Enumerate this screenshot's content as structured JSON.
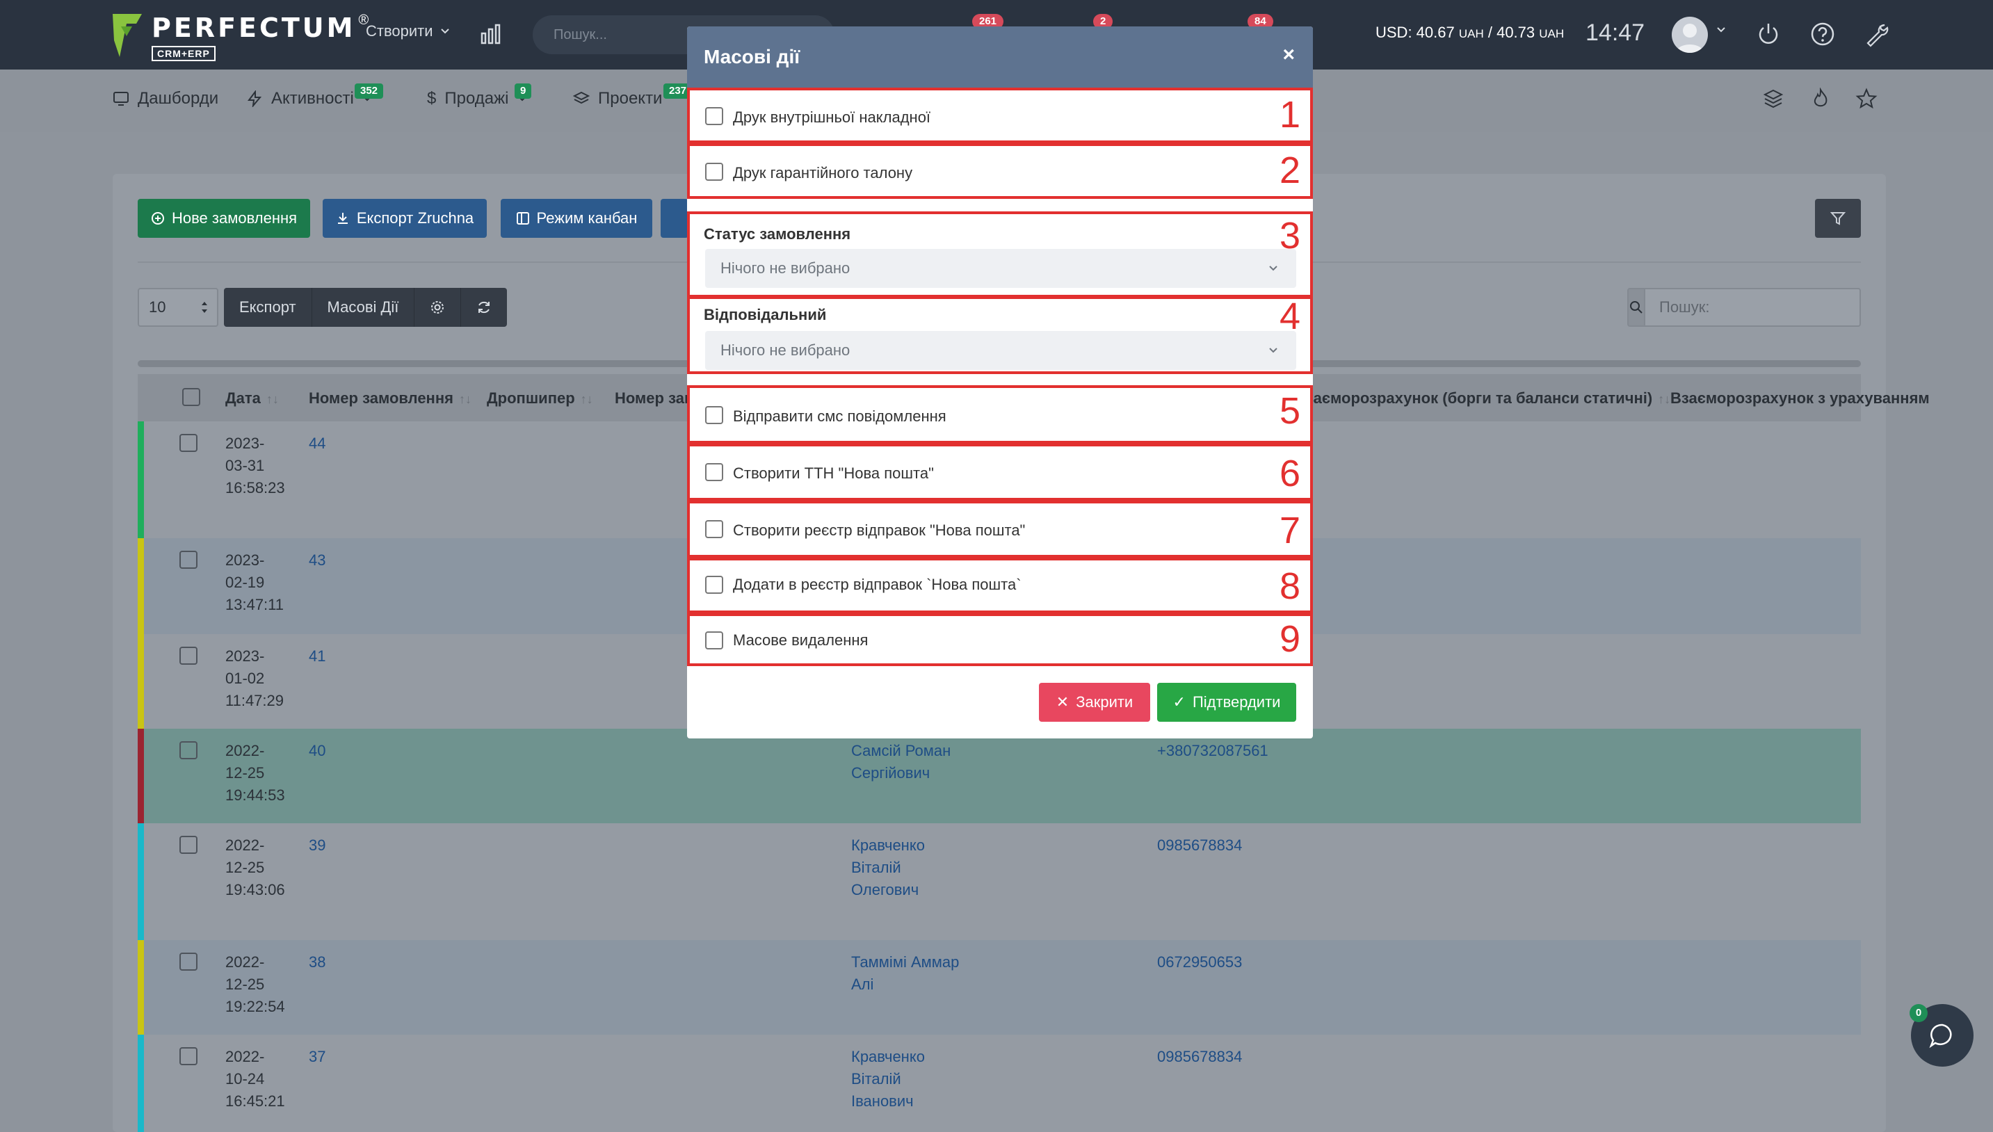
{
  "topbar": {
    "logo_title": "PERFECTUM",
    "logo_reg": "®",
    "logo_sub": "CRM+ERP",
    "create_label": "Створити",
    "search_placeholder": "Пошук...",
    "badges": [
      "261",
      "2",
      "84"
    ],
    "currency_prefix": "USD: 40.67 ",
    "currency_unit1": "UAH",
    "currency_mid": " / 40.73 ",
    "currency_unit2": "UAH",
    "time": "14:47"
  },
  "nav": {
    "items": [
      {
        "label": "Дашборди",
        "icon": "monitor-icon"
      },
      {
        "label": "Активності",
        "icon": "bolt-icon",
        "badge": "352"
      },
      {
        "label": "Продажі",
        "icon": "dollar-icon",
        "badge": "9"
      },
      {
        "label": "Проекти",
        "icon": "layers-icon",
        "badge": "237"
      }
    ]
  },
  "toolbar": {
    "new_order": "Нове замовлення",
    "export_zruchna": "Експорт Zruchna",
    "kanban": "Режим канбан",
    "page_size": "10",
    "export": "Експорт",
    "mass_actions": "Масові Дії",
    "search_placeholder": "Пошук:"
  },
  "table": {
    "headers": {
      "date": "Дата",
      "order_number": "Номер замовлення",
      "dropshipper": "Дропшипер",
      "number_partial": "Номер зам",
      "mutual_static": "заєморозрахунок (борги та баланси статичні)",
      "mutual_with": "Взаєморозрахунок з урахуванням"
    },
    "rows": [
      {
        "date": [
          "2023-",
          "03-31",
          "16:58:23"
        ],
        "number": "44",
        "client": [],
        "phone": "",
        "color": "#1fae5c"
      },
      {
        "date": [
          "2023-",
          "02-19",
          "13:47:11"
        ],
        "number": "43",
        "client": [],
        "phone": "",
        "color": "#c9c414"
      },
      {
        "date": [
          "2023-",
          "01-02",
          "11:47:29"
        ],
        "number": "41",
        "client": [],
        "phone": "",
        "color": "#c9c414"
      },
      {
        "date": [
          "2022-",
          "12-25",
          "19:44:53"
        ],
        "number": "40",
        "client": [
          "Самсій Роман",
          "Сергійович"
        ],
        "phone": "+380732087561",
        "color": "#9b2431"
      },
      {
        "date": [
          "2022-",
          "12-25",
          "19:43:06"
        ],
        "number": "39",
        "client": [
          "Кравченко",
          "Віталій",
          "Олегович"
        ],
        "phone": "0985678834",
        "color": "#1ab8c9"
      },
      {
        "date": [
          "2022-",
          "12-25",
          "19:22:54"
        ],
        "number": "38",
        "client": [
          "Таммімі Аммар",
          "Алі"
        ],
        "phone": "0672950653",
        "color": "#c9c414"
      },
      {
        "date": [
          "2022-",
          "10-24",
          "16:45:21"
        ],
        "number": "37",
        "client": [
          "Кравченко",
          "Віталій",
          "Іванович"
        ],
        "phone": "0985678834",
        "color": "#1ab8c9"
      }
    ]
  },
  "modal": {
    "title": "Масові дії",
    "close_symbol": "×",
    "options": {
      "print_invoice": "Друк внутрішньої накладної",
      "print_warranty": "Друк гарантійного талону",
      "order_status_label": "Статус замовлення",
      "order_status_value": "Нічого не вибрано",
      "responsible_label": "Відповідальний",
      "responsible_value": "Нічого не вибрано",
      "send_sms": "Відправити смс повідомлення",
      "create_ttn": "Створити ТТН \"Нова пошта\"",
      "create_registry": "Створити реєстр відправок \"Нова пошта\"",
      "add_registry": "Додати в реєстр відправок `Нова пошта`",
      "mass_delete": "Масове видалення"
    },
    "markers": [
      "1",
      "2",
      "3",
      "4",
      "5",
      "6",
      "7",
      "8",
      "9"
    ],
    "close_button": "Закрити",
    "confirm_button": "Підтвердити"
  },
  "chat": {
    "badge": "0"
  },
  "colors": {
    "modal_header": "#5e7390",
    "annotation_red": "#e2302f",
    "confirm_green": "#28a745",
    "close_red": "#e8475f"
  }
}
